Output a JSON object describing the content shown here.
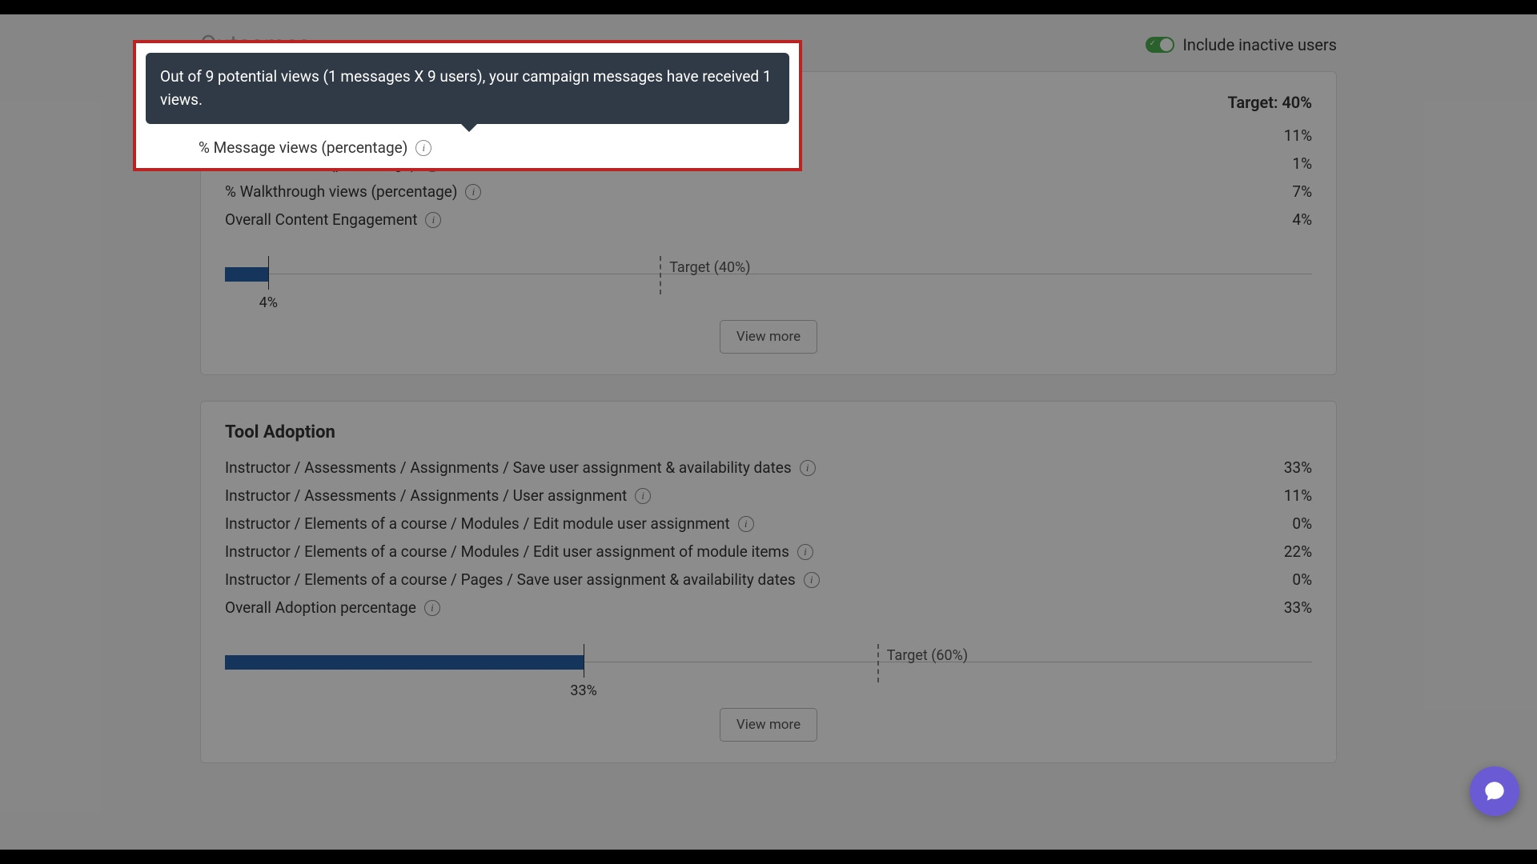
{
  "header": {
    "title": "Outcomes",
    "toggle_label": "Include inactive users"
  },
  "tooltip": {
    "text": "Out of 9 potential views (1 messages X 9 users), your campaign messages have received 1 views."
  },
  "content_engagement": {
    "target_label": "Target: 40%",
    "metrics": [
      {
        "label": "% Message views (percentage)",
        "value": "11%"
      },
      {
        "label": "% Article views (percentage)",
        "value": "1%"
      },
      {
        "label": "% Walkthrough views (percentage)",
        "value": "7%"
      },
      {
        "label": "Overall Content Engagement",
        "value": "4%"
      }
    ],
    "bar_value_label": "4%",
    "target_marker_label": "Target (40%)",
    "view_more": "View more"
  },
  "tool_adoption": {
    "title": "Tool Adoption",
    "metrics": [
      {
        "label": "Instructor / Assessments / Assignments / Save user assignment & availability dates",
        "value": "33%"
      },
      {
        "label": "Instructor / Assessments / Assignments / User assignment",
        "value": "11%"
      },
      {
        "label": "Instructor / Elements of a course / Modules / Edit module user assignment",
        "value": "0%"
      },
      {
        "label": "Instructor / Elements of a course / Modules / Edit user assignment of module items",
        "value": "22%"
      },
      {
        "label": "Instructor / Elements of a course / Pages / Save user assignment & availability dates",
        "value": "0%"
      },
      {
        "label": "Overall Adoption percentage",
        "value": "33%"
      }
    ],
    "bar_value_label": "33%",
    "target_marker_label": "Target (60%)",
    "view_more": "View more"
  },
  "chart_data": [
    {
      "type": "bar",
      "title": "Overall Content Engagement",
      "categories": [
        "Overall Content Engagement"
      ],
      "values": [
        4
      ],
      "target": 40,
      "xlim": [
        0,
        100
      ],
      "unit": "%"
    },
    {
      "type": "bar",
      "title": "Overall Adoption percentage",
      "categories": [
        "Overall Adoption percentage"
      ],
      "values": [
        33
      ],
      "target": 60,
      "xlim": [
        0,
        100
      ],
      "unit": "%"
    }
  ]
}
